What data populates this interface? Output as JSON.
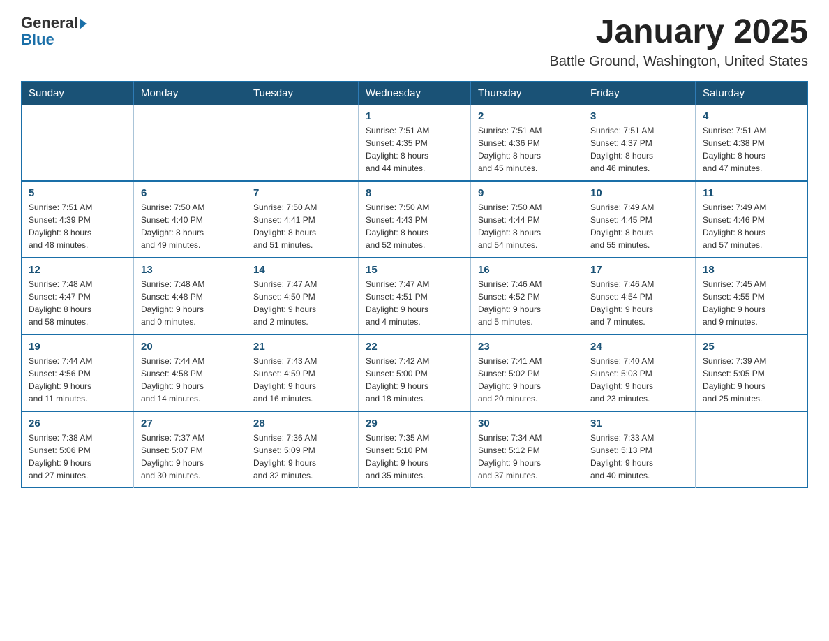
{
  "header": {
    "logo_general": "General",
    "logo_blue": "Blue",
    "month_title": "January 2025",
    "location": "Battle Ground, Washington, United States"
  },
  "weekdays": [
    "Sunday",
    "Monday",
    "Tuesday",
    "Wednesday",
    "Thursday",
    "Friday",
    "Saturday"
  ],
  "weeks": [
    [
      {
        "day": "",
        "info": ""
      },
      {
        "day": "",
        "info": ""
      },
      {
        "day": "",
        "info": ""
      },
      {
        "day": "1",
        "info": "Sunrise: 7:51 AM\nSunset: 4:35 PM\nDaylight: 8 hours\nand 44 minutes."
      },
      {
        "day": "2",
        "info": "Sunrise: 7:51 AM\nSunset: 4:36 PM\nDaylight: 8 hours\nand 45 minutes."
      },
      {
        "day": "3",
        "info": "Sunrise: 7:51 AM\nSunset: 4:37 PM\nDaylight: 8 hours\nand 46 minutes."
      },
      {
        "day": "4",
        "info": "Sunrise: 7:51 AM\nSunset: 4:38 PM\nDaylight: 8 hours\nand 47 minutes."
      }
    ],
    [
      {
        "day": "5",
        "info": "Sunrise: 7:51 AM\nSunset: 4:39 PM\nDaylight: 8 hours\nand 48 minutes."
      },
      {
        "day": "6",
        "info": "Sunrise: 7:50 AM\nSunset: 4:40 PM\nDaylight: 8 hours\nand 49 minutes."
      },
      {
        "day": "7",
        "info": "Sunrise: 7:50 AM\nSunset: 4:41 PM\nDaylight: 8 hours\nand 51 minutes."
      },
      {
        "day": "8",
        "info": "Sunrise: 7:50 AM\nSunset: 4:43 PM\nDaylight: 8 hours\nand 52 minutes."
      },
      {
        "day": "9",
        "info": "Sunrise: 7:50 AM\nSunset: 4:44 PM\nDaylight: 8 hours\nand 54 minutes."
      },
      {
        "day": "10",
        "info": "Sunrise: 7:49 AM\nSunset: 4:45 PM\nDaylight: 8 hours\nand 55 minutes."
      },
      {
        "day": "11",
        "info": "Sunrise: 7:49 AM\nSunset: 4:46 PM\nDaylight: 8 hours\nand 57 minutes."
      }
    ],
    [
      {
        "day": "12",
        "info": "Sunrise: 7:48 AM\nSunset: 4:47 PM\nDaylight: 8 hours\nand 58 minutes."
      },
      {
        "day": "13",
        "info": "Sunrise: 7:48 AM\nSunset: 4:48 PM\nDaylight: 9 hours\nand 0 minutes."
      },
      {
        "day": "14",
        "info": "Sunrise: 7:47 AM\nSunset: 4:50 PM\nDaylight: 9 hours\nand 2 minutes."
      },
      {
        "day": "15",
        "info": "Sunrise: 7:47 AM\nSunset: 4:51 PM\nDaylight: 9 hours\nand 4 minutes."
      },
      {
        "day": "16",
        "info": "Sunrise: 7:46 AM\nSunset: 4:52 PM\nDaylight: 9 hours\nand 5 minutes."
      },
      {
        "day": "17",
        "info": "Sunrise: 7:46 AM\nSunset: 4:54 PM\nDaylight: 9 hours\nand 7 minutes."
      },
      {
        "day": "18",
        "info": "Sunrise: 7:45 AM\nSunset: 4:55 PM\nDaylight: 9 hours\nand 9 minutes."
      }
    ],
    [
      {
        "day": "19",
        "info": "Sunrise: 7:44 AM\nSunset: 4:56 PM\nDaylight: 9 hours\nand 11 minutes."
      },
      {
        "day": "20",
        "info": "Sunrise: 7:44 AM\nSunset: 4:58 PM\nDaylight: 9 hours\nand 14 minutes."
      },
      {
        "day": "21",
        "info": "Sunrise: 7:43 AM\nSunset: 4:59 PM\nDaylight: 9 hours\nand 16 minutes."
      },
      {
        "day": "22",
        "info": "Sunrise: 7:42 AM\nSunset: 5:00 PM\nDaylight: 9 hours\nand 18 minutes."
      },
      {
        "day": "23",
        "info": "Sunrise: 7:41 AM\nSunset: 5:02 PM\nDaylight: 9 hours\nand 20 minutes."
      },
      {
        "day": "24",
        "info": "Sunrise: 7:40 AM\nSunset: 5:03 PM\nDaylight: 9 hours\nand 23 minutes."
      },
      {
        "day": "25",
        "info": "Sunrise: 7:39 AM\nSunset: 5:05 PM\nDaylight: 9 hours\nand 25 minutes."
      }
    ],
    [
      {
        "day": "26",
        "info": "Sunrise: 7:38 AM\nSunset: 5:06 PM\nDaylight: 9 hours\nand 27 minutes."
      },
      {
        "day": "27",
        "info": "Sunrise: 7:37 AM\nSunset: 5:07 PM\nDaylight: 9 hours\nand 30 minutes."
      },
      {
        "day": "28",
        "info": "Sunrise: 7:36 AM\nSunset: 5:09 PM\nDaylight: 9 hours\nand 32 minutes."
      },
      {
        "day": "29",
        "info": "Sunrise: 7:35 AM\nSunset: 5:10 PM\nDaylight: 9 hours\nand 35 minutes."
      },
      {
        "day": "30",
        "info": "Sunrise: 7:34 AM\nSunset: 5:12 PM\nDaylight: 9 hours\nand 37 minutes."
      },
      {
        "day": "31",
        "info": "Sunrise: 7:33 AM\nSunset: 5:13 PM\nDaylight: 9 hours\nand 40 minutes."
      },
      {
        "day": "",
        "info": ""
      }
    ]
  ]
}
